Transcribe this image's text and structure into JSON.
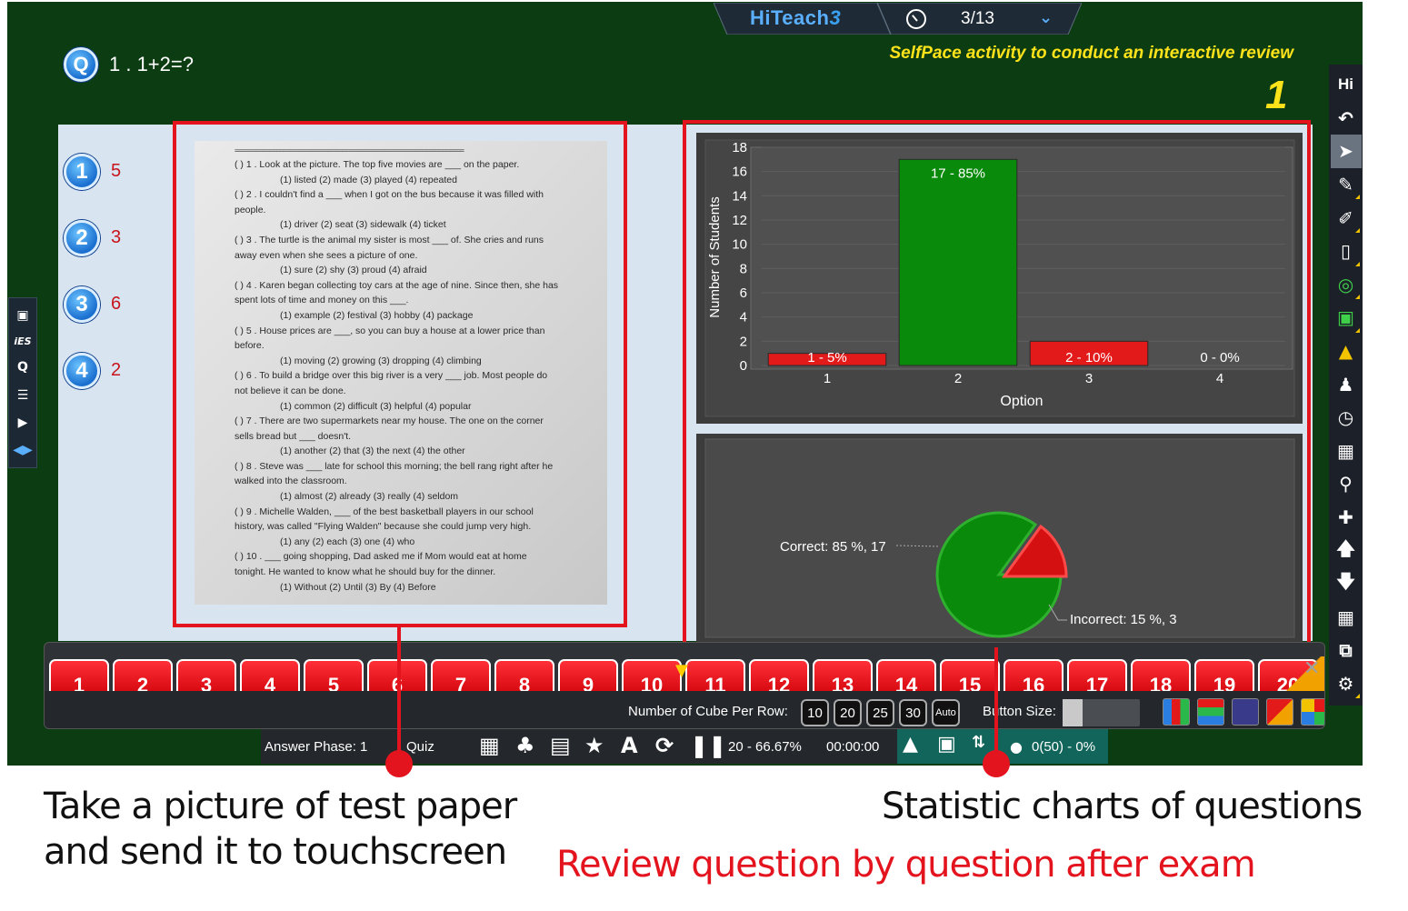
{
  "header": {
    "brand_hi": "HiTeach",
    "brand_3": "3",
    "page_indicator": "3/13",
    "subtitle": "SelfPace activity to conduct an interactive review",
    "corner_number": "1"
  },
  "question": {
    "badge": "Q",
    "text": "1 . 1+2=?"
  },
  "options": [
    {
      "badge": "1",
      "count": "5"
    },
    {
      "badge": "2",
      "count": "3"
    },
    {
      "badge": "3",
      "count": "6"
    },
    {
      "badge": "4",
      "count": "2"
    }
  ],
  "test_paper": {
    "rule": "==================================================================",
    "lines": [
      {
        "text": "(        ) 1 . Look at the picture. The top five movies are ___ on the paper.",
        "sub": false
      },
      {
        "text": "(1) listed    (2) made    (3) played    (4) repeated",
        "sub": true
      },
      {
        "text": "(        ) 2 . I couldn't find a ___ when I got on the bus because it was filled with",
        "sub": false
      },
      {
        "text": "people.",
        "sub": false
      },
      {
        "text": "(1) driver    (2) seat    (3) sidewalk    (4) ticket",
        "sub": true
      },
      {
        "text": "(        ) 3 . The turtle is the animal my sister is most ___ of. She cries and runs",
        "sub": false
      },
      {
        "text": "away even when she sees a picture of one.",
        "sub": false
      },
      {
        "text": "(1) sure    (2) shy    (3) proud    (4) afraid",
        "sub": true
      },
      {
        "text": "(        ) 4 . Karen began collecting toy cars at the age of nine. Since then, she has",
        "sub": false
      },
      {
        "text": "spent lots of time and money on this ___.",
        "sub": false
      },
      {
        "text": "(1) example    (2) festival    (3) hobby    (4) package",
        "sub": true
      },
      {
        "text": "(        ) 5 . House prices are ___, so you can buy a house at a lower price than",
        "sub": false
      },
      {
        "text": "before.",
        "sub": false
      },
      {
        "text": "(1) moving    (2) growing    (3) dropping    (4) climbing",
        "sub": true
      },
      {
        "text": "(        ) 6 . To build a bridge over this big river is a very ___ job. Most people do",
        "sub": false
      },
      {
        "text": "not believe it can be done.",
        "sub": false
      },
      {
        "text": "(1) common    (2) difficult    (3) helpful    (4) popular",
        "sub": true
      },
      {
        "text": "(        ) 7 . There are two supermarkets near my house. The one on the corner",
        "sub": false
      },
      {
        "text": "sells bread but ___ doesn't.",
        "sub": false
      },
      {
        "text": "(1) another    (2) that    (3) the next    (4) the other",
        "sub": true
      },
      {
        "text": "(        ) 8 . Steve was ___ late for school this morning; the bell rang right after he",
        "sub": false
      },
      {
        "text": "walked into the classroom.",
        "sub": false
      },
      {
        "text": "(1) almost    (2) already    (3) really    (4) seldom",
        "sub": true
      },
      {
        "text": "(        ) 9 . Michelle Walden, ___ of the best basketball players in our school",
        "sub": false
      },
      {
        "text": "history, was called \"Flying Walden\" because she could jump very high.",
        "sub": false
      },
      {
        "text": "(1) any    (2) each    (3) one    (4) who",
        "sub": true
      },
      {
        "text": "(        ) 10 . ___ going shopping, Dad asked me if Mom would eat at home",
        "sub": false
      },
      {
        "text": "tonight. He wanted to know what he should buy for the dinner.",
        "sub": false
      },
      {
        "text": "(1) Without    (2) Until    (3) By    (4) Before",
        "sub": true
      }
    ]
  },
  "chart_data": [
    {
      "type": "bar",
      "categories": [
        "1",
        "2",
        "3",
        "4"
      ],
      "values": [
        1,
        17,
        2,
        0
      ],
      "data_labels": [
        "1 - 5%",
        "17 - 85%",
        "2 - 10%",
        "0 - 0%"
      ],
      "bar_colors": [
        "#e21a1a",
        "#0a8a0a",
        "#e21a1a",
        "#e21a1a"
      ],
      "xlabel": "Option",
      "ylabel": "Number of Students",
      "ylim": [
        0,
        18
      ],
      "yticks": [
        "0",
        "2",
        "4",
        "6",
        "8",
        "10",
        "12",
        "14",
        "16",
        "18"
      ]
    },
    {
      "type": "pie",
      "slices": [
        {
          "label": "Correct: 85 %, 17",
          "value": 85,
          "color": "#0a8a0a"
        },
        {
          "label": "Incorrect: 15 %, 3",
          "value": 15,
          "color": "#d41010"
        }
      ]
    }
  ],
  "left_tools": [
    "image-icon",
    "ies-icon",
    "question-icon",
    "menu-icon",
    "play-icon",
    "split-arrows-icon"
  ],
  "left_tool_labels": {
    "ies": "iES",
    "q": "Q"
  },
  "right_tools": {
    "hi": "Hi",
    "items": [
      "undo-icon",
      "pointer-icon",
      "pen-icon",
      "highlighter-icon",
      "eraser-icon",
      "laser-icon",
      "hd-camera-icon",
      "stamp-icon",
      "student-icon",
      "timer-icon",
      "grade-icon",
      "magnifier-icon",
      "plus-icon",
      "up-arrow-icon",
      "down-arrow-icon",
      "trash-icon",
      "expand-icon",
      "settings-icon"
    ]
  },
  "cube_strip": {
    "cubes": [
      "1",
      "2",
      "3",
      "4",
      "5",
      "6",
      "7",
      "8",
      "9",
      "10",
      "11",
      "12",
      "13",
      "14",
      "15",
      "16",
      "17",
      "18",
      "19",
      "20"
    ],
    "per_row_label": "Number of Cube Per Row:",
    "per_row_options": [
      "10",
      "20",
      "25",
      "30",
      "Auto"
    ],
    "button_size_label": "Button Size:",
    "layout_icons": [
      "numbered-grid-icon",
      "stacked-numbers-icon",
      "score-100-icon",
      "score-75-icon",
      "color-grid-icon"
    ]
  },
  "status_bar": {
    "phase": "Answer Phase: 1",
    "mode": "Quiz",
    "progress": "20 - 66.67%",
    "timer": "00:00:00",
    "answers": "0(50) - 0%"
  },
  "captions": {
    "left_line1": "Take a picture of test paper",
    "left_line2": "and send it to touchscreen",
    "right": "Statistic charts of questions",
    "bottom": "Review question by question after exam"
  },
  "colors": {
    "board": "#0c3d12",
    "accent_red": "#e4141e",
    "accent_yellow": "#ffe31a",
    "brand_blue": "#5ab0ff"
  }
}
